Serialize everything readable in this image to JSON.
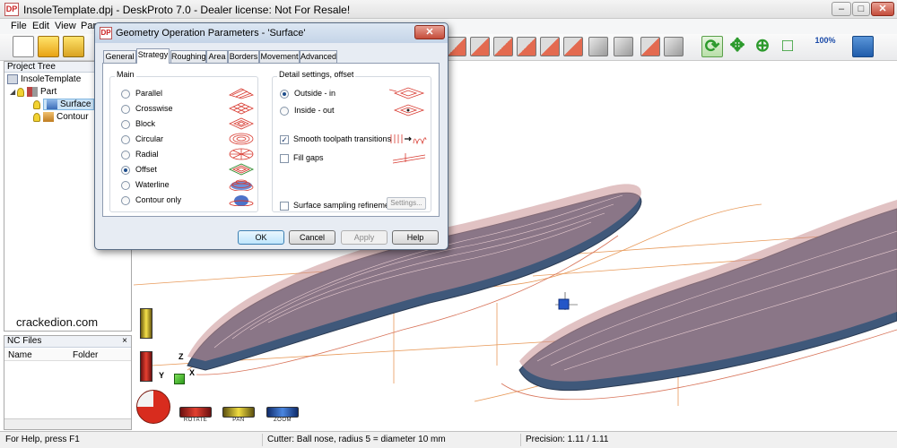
{
  "window": {
    "title": "InsoleTemplate.dpj - DeskProto 7.0 - Dealer license:  Not For Resale!",
    "app_icon_text": "DP",
    "minimize": "–",
    "maximize": "□",
    "close": "✕"
  },
  "menu": [
    "File",
    "Edit",
    "View",
    "Para"
  ],
  "project_tree": {
    "header": "Project Tree",
    "items": [
      {
        "label": "InsoleTemplate",
        "icon": "project-icon"
      },
      {
        "label": "Part",
        "icon": "part-icon"
      },
      {
        "label": "Surface",
        "icon": "surface-icon",
        "selected": true
      },
      {
        "label": "Contour",
        "icon": "contour-icon"
      }
    ]
  },
  "watermark": "crackedion.com",
  "nc_files": {
    "header": "NC Files",
    "close": "×",
    "columns": [
      "Name",
      "Folder"
    ]
  },
  "viewport": {
    "axes": {
      "x": "X",
      "y": "Y",
      "z": "Z"
    },
    "nav_buttons": [
      "ROTATE",
      "PAN",
      "ZOOM"
    ],
    "zoom_icon_text": "100%",
    "toolpath_color": "#e8845c",
    "surface_color": "#3f587a"
  },
  "status_bar": {
    "help": "For Help, press F1",
    "cutter": "Cutter: Ball nose, radius 5 = diameter 10 mm",
    "precision": "Precision: 1.11 / 1.11"
  },
  "dialog": {
    "title": "Geometry Operation Parameters - 'Surface'",
    "icon_text": "DP",
    "close": "✕",
    "tabs": [
      "General",
      "Strategy",
      "Roughing",
      "Area",
      "Borders",
      "Movement",
      "Advanced"
    ],
    "active_tab": "Strategy",
    "main_group": {
      "label": "Main",
      "options": [
        "Parallel",
        "Crosswise",
        "Block",
        "Circular",
        "Radial",
        "Offset",
        "Waterline",
        "Contour only"
      ],
      "selected": "Offset"
    },
    "detail_group": {
      "label": "Detail settings, offset",
      "options": [
        "Outside - in",
        "Inside - out"
      ],
      "selected": "Outside - in",
      "smooth_transitions": {
        "label": "Smooth toolpath transitions",
        "checked": true
      },
      "fill_gaps": {
        "label": "Fill gaps",
        "checked": false
      },
      "surface_sampling": {
        "label": "Surface sampling refinement",
        "checked": false
      },
      "settings_button": "Settings..."
    },
    "buttons": {
      "ok": "OK",
      "cancel": "Cancel",
      "apply": "Apply",
      "help": "Help"
    }
  }
}
